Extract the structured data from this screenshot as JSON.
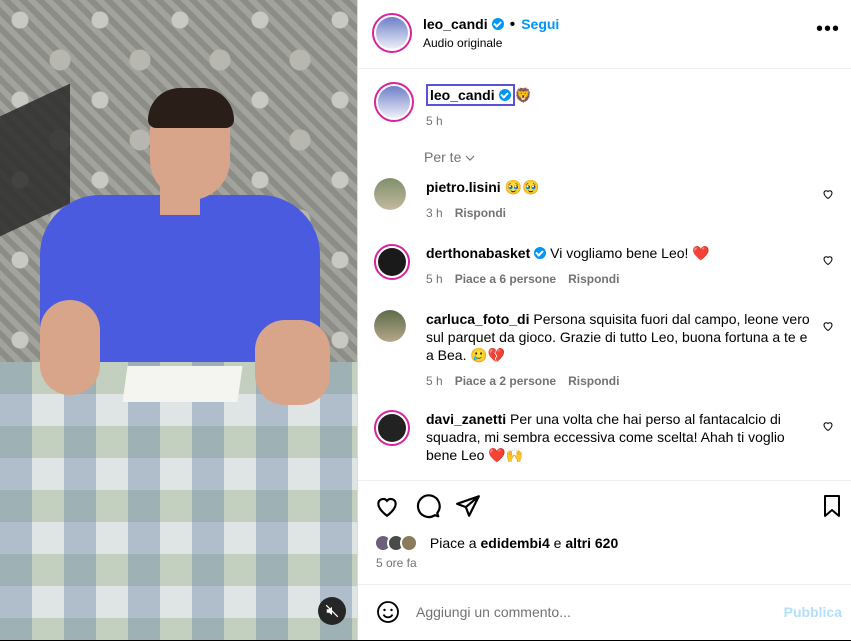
{
  "header": {
    "username": "leo_candi",
    "dot": "•",
    "follow_label": "Segui",
    "audio": "Audio originale",
    "more": "•••"
  },
  "caption": {
    "username": "leo_candi",
    "emoji": "🦁",
    "time": "5 h"
  },
  "sort_label": "Per te ",
  "comments": [
    {
      "user": "pietro.lisini",
      "text": "🥹🥹",
      "time": "3 h",
      "likes": "",
      "reply": "Rispondi"
    },
    {
      "user": "derthonabasket",
      "text": "Vi vogliamo bene Leo! ❤️",
      "time": "5 h",
      "likes": "Piace a 6 persone",
      "reply": "Rispondi"
    },
    {
      "user": "carluca_foto_di",
      "text": "Persona squisita fuori dal campo, leone vero sul parquet da gioco. Grazie di tutto Leo, buona fortuna a te e a Bea. 🥲💔",
      "time": "5 h",
      "likes": "Piace a 2 persone",
      "reply": "Rispondi"
    },
    {
      "user": "davi_zanetti",
      "text": "Per una volta che hai perso al fantacalcio di squadra, mi sembra eccessiva come scelta! Ahah ti voglio bene Leo ❤️🙌",
      "time": "",
      "likes": "",
      "reply": ""
    }
  ],
  "likes_line": {
    "prefix": "Piace a ",
    "user": "edidembi4",
    "middle": " e ",
    "others": "altri 620"
  },
  "post_time": "5 ore fa",
  "add_comment": {
    "placeholder": "Aggiungi un commento...",
    "publish": "Pubblica"
  },
  "icons": {
    "mute": "speaker-muted-icon",
    "like": "heart-icon",
    "comment": "comment-icon",
    "share": "paper-plane-icon",
    "save": "bookmark-icon",
    "emoji": "emoji-smiley-icon"
  },
  "colors": {
    "accent": "#0095f6",
    "text_muted": "#737373",
    "publish_disabled": "#b2dffc",
    "like_red": "#ed4956"
  }
}
